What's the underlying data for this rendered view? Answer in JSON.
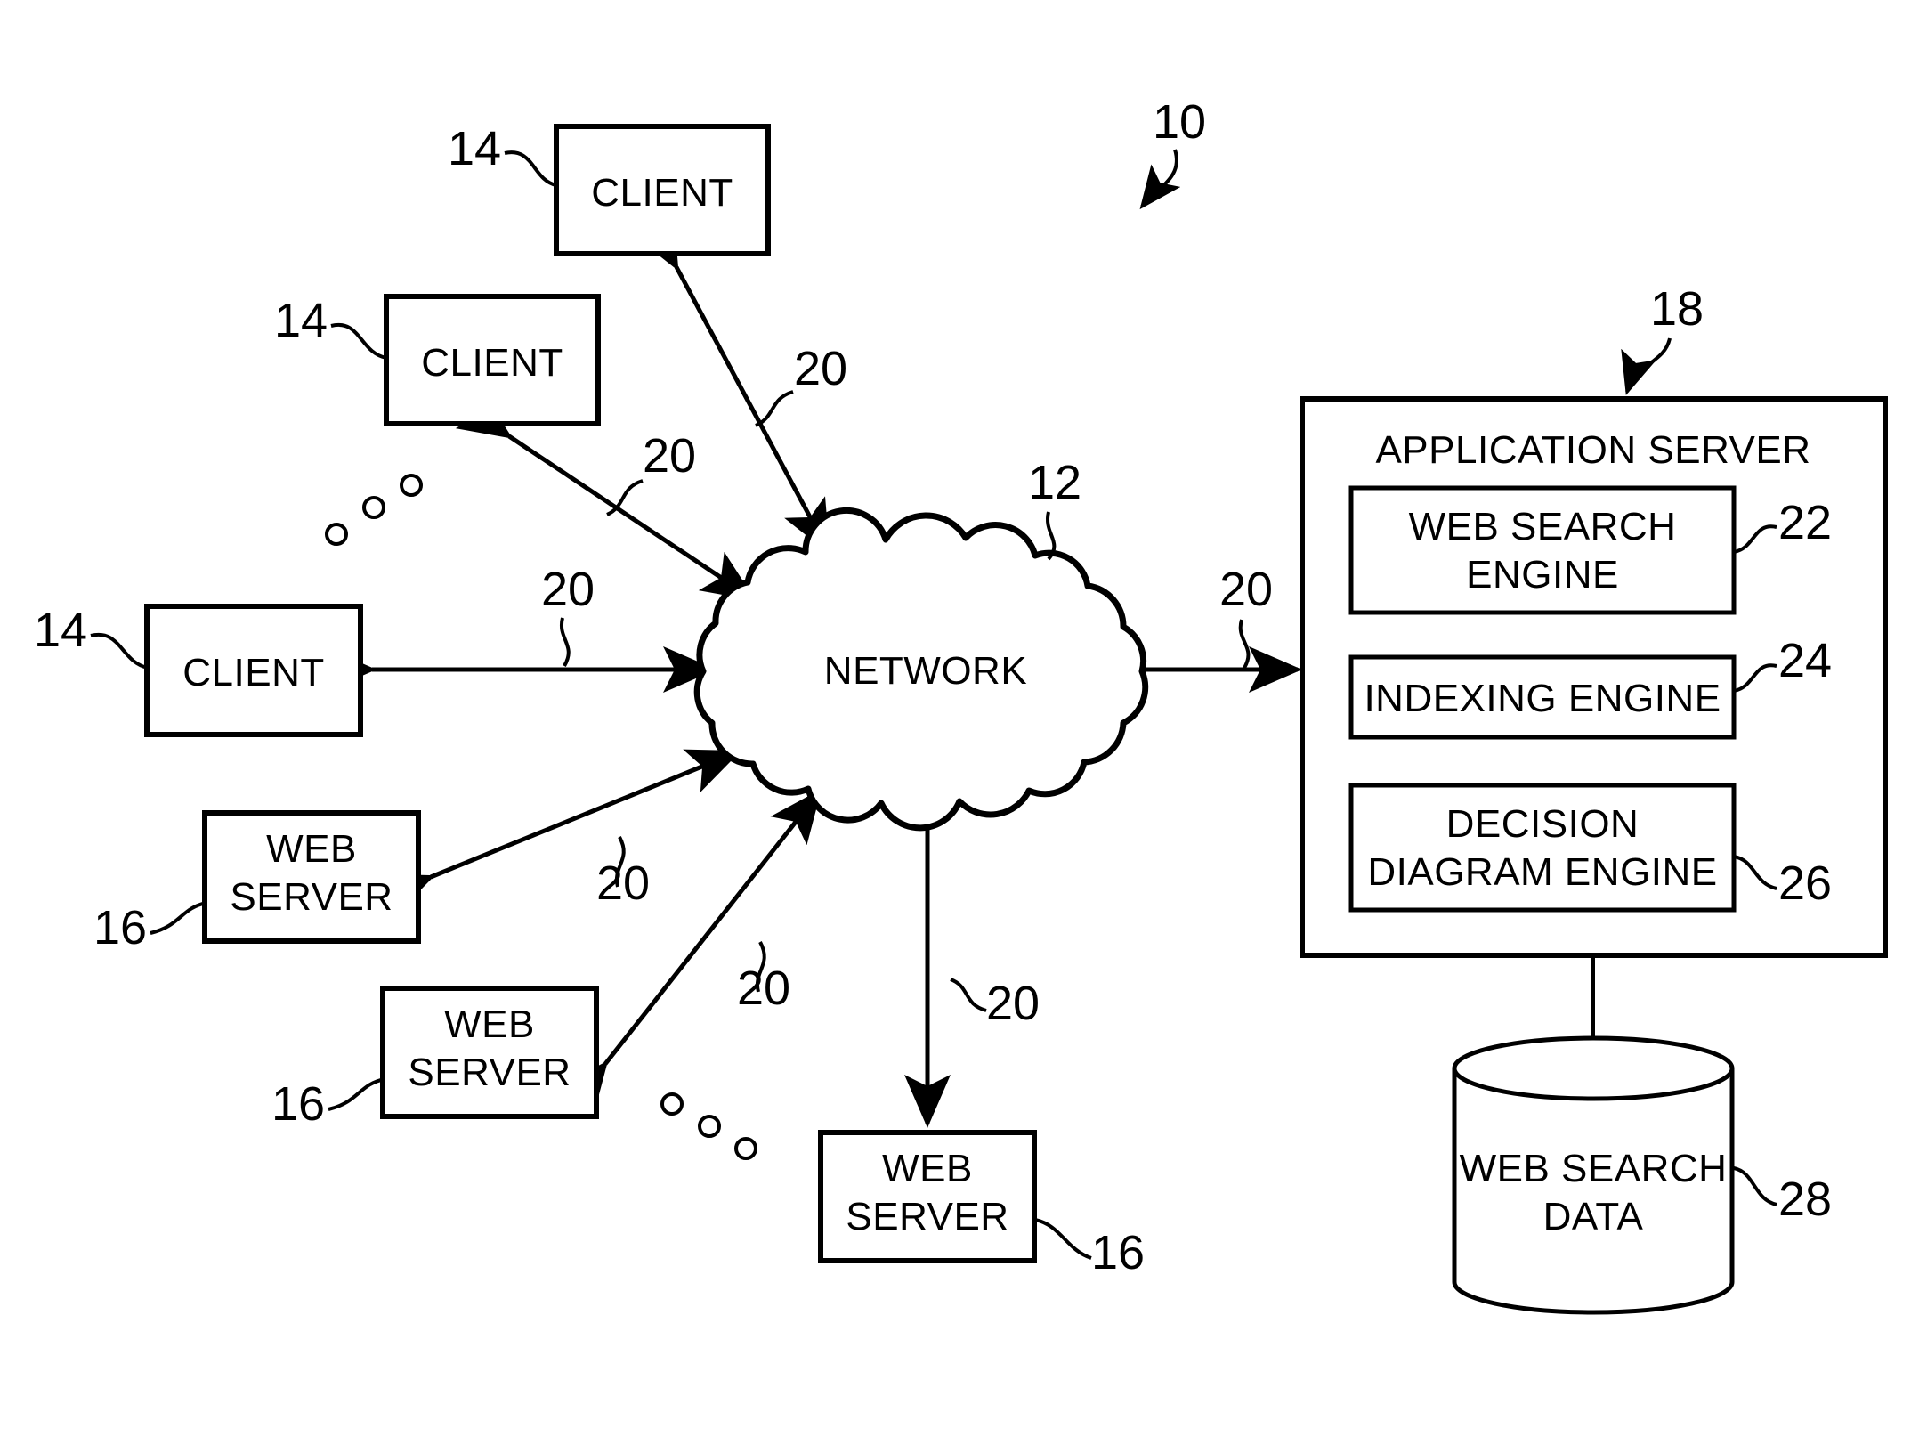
{
  "figure": {
    "system_ref": "10",
    "network_ref": "12",
    "client_ref": "14",
    "web_server_ref": "16",
    "application_server_ref": "18",
    "connection_ref": "20",
    "web_search_engine_ref": "22",
    "indexing_engine_ref": "24",
    "decision_diagram_engine_ref": "26",
    "web_search_data_ref": "28"
  },
  "nodes": {
    "clients": [
      {
        "label": "CLIENT",
        "ref": "14"
      },
      {
        "label": "CLIENT",
        "ref": "14"
      },
      {
        "label": "CLIENT",
        "ref": "14"
      }
    ],
    "web_servers": [
      {
        "label_line1": "WEB",
        "label_line2": "SERVER",
        "ref": "16"
      },
      {
        "label_line1": "WEB",
        "label_line2": "SERVER",
        "ref": "16"
      },
      {
        "label_line1": "WEB",
        "label_line2": "SERVER",
        "ref": "16"
      }
    ],
    "network": {
      "label": "NETWORK",
      "ref": "12"
    },
    "application_server": {
      "title": "APPLICATION SERVER",
      "ref": "18",
      "modules": [
        {
          "line1": "WEB SEARCH",
          "line2": "ENGINE",
          "ref": "22"
        },
        {
          "line1": "INDEXING ENGINE",
          "line2": "",
          "ref": "24"
        },
        {
          "line1": "DECISION",
          "line2": "DIAGRAM ENGINE",
          "ref": "26"
        }
      ]
    },
    "datastore": {
      "line1": "WEB SEARCH",
      "line2": "DATA",
      "ref": "28"
    }
  },
  "connection_labels": [
    "20",
    "20",
    "20",
    "20",
    "20",
    "20",
    "20"
  ],
  "colors": {
    "ink": "#000000",
    "paper": "#ffffff"
  }
}
